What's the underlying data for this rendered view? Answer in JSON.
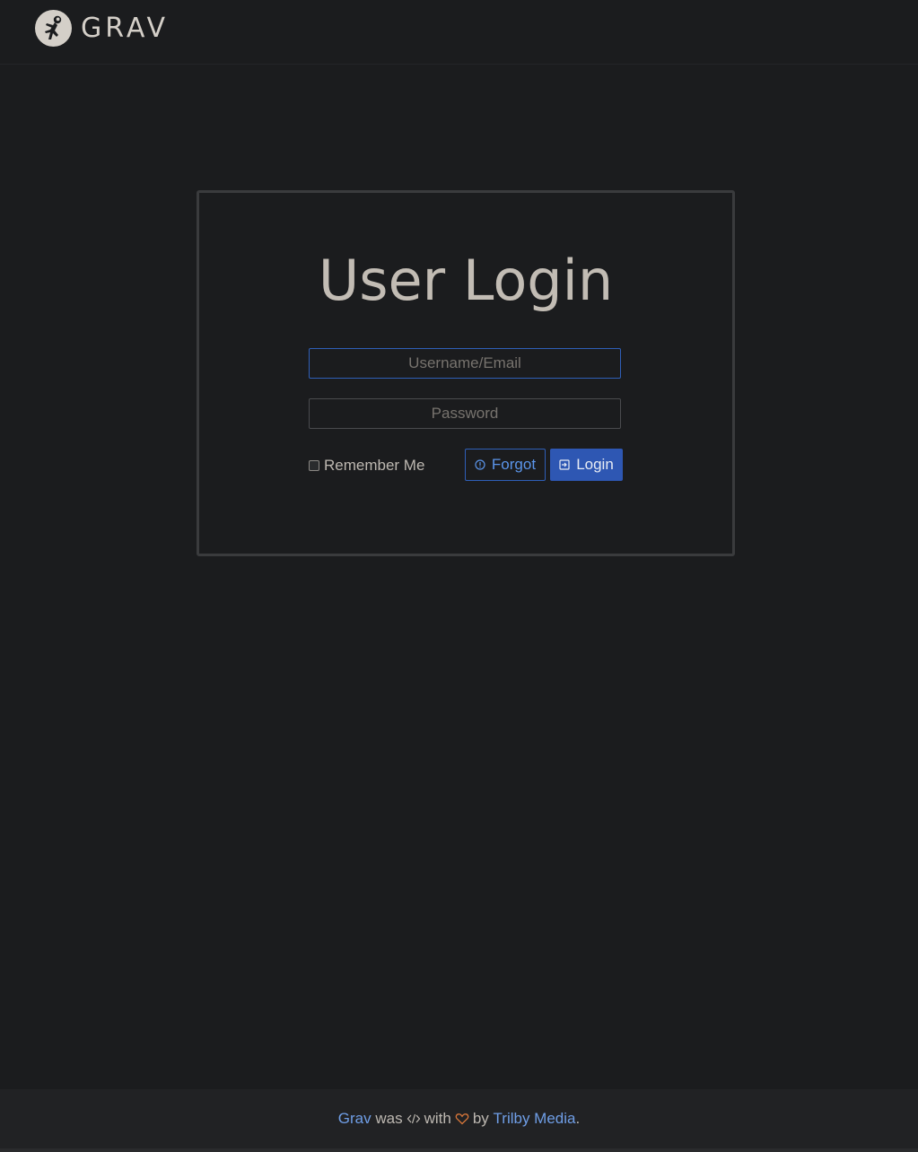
{
  "header": {
    "brand": "GRAV",
    "logo_icon": "grav-astronaut-logo"
  },
  "login": {
    "title": "User Login",
    "username_placeholder": "Username/Email",
    "password_placeholder": "Password",
    "remember_label": "Remember Me",
    "forgot_label": "Forgot",
    "login_label": "Login",
    "forgot_icon": "info-circle-icon",
    "login_icon": "sign-in-icon"
  },
  "footer": {
    "grav_link": "Grav",
    "was": "was",
    "code_icon": "code-icon",
    "with": "with",
    "heart_icon": "heart-icon",
    "by": "by",
    "author_link": "Trilby Media",
    "period": "."
  },
  "colors": {
    "background": "#1b1c1e",
    "accent": "#2e57b3",
    "link": "#6f9ee6",
    "heart": "#d9773a"
  }
}
